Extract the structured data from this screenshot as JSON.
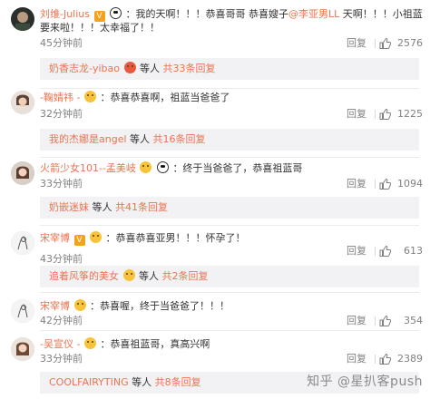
{
  "comments": [
    {
      "user": "刘维-Julius",
      "badge": "V",
      "line1": "：我的天啊！！！恭喜哥哥 恭喜嫂子",
      "mention": "@李亚男LL",
      "line1b": " 天啊！！！小祖蓝！",
      "line2": "要来啦！！！太幸福了！！",
      "time": "45分钟前",
      "reply_label": "回复",
      "likes": "2576",
      "replies_user": "奶香志龙-yibao",
      "replies_text": "等人 ",
      "replies_count": "共33条回复"
    },
    {
      "user": "-鞠婧祎 -",
      "text": "：恭喜恭喜啊，祖蓝当爸爸了",
      "time": "32分钟前",
      "reply_label": "回复",
      "likes": "1225",
      "replies_user": "我的杰娜是angel",
      "replies_text": " 等人 ",
      "replies_count": "共16条回复"
    },
    {
      "user": "火箭少女101--孟美岐",
      "text": "：终于当爸爸了，恭喜祖蓝哥",
      "time": "33分钟前",
      "reply_label": "回复",
      "likes": "1094",
      "replies_user": "奶嵌迷妹",
      "replies_text": " 等人 ",
      "replies_count": "共41条回复"
    },
    {
      "user": "宋宰博",
      "badge": "V",
      "text": "：恭喜恭喜亚男！！！怀孕了！",
      "time": "43分钟前",
      "reply_label": "回复",
      "likes": "613",
      "replies_user": "追着风筝的美女",
      "replies_text": " 等人 ",
      "replies_count": "共2条回复"
    },
    {
      "user": "宋宰博",
      "text": "：恭喜喔，终于当爸爸了！！！",
      "time": "42分钟前",
      "reply_label": "回复",
      "likes": "354"
    },
    {
      "user": "-吴宣仪 -",
      "text": "：恭喜祖蓝哥，真高兴啊",
      "time": "33分钟前",
      "reply_label": "回复",
      "likes": "2389",
      "replies_user": "COOLFAIRYTING",
      "replies_text": " 等人 ",
      "replies_count": "共8条回复"
    }
  ],
  "watermark": "知乎 @星扒客push",
  "colors": {
    "accent": "#eb7350",
    "muted": "#808080",
    "panel": "#f2f2f5"
  }
}
